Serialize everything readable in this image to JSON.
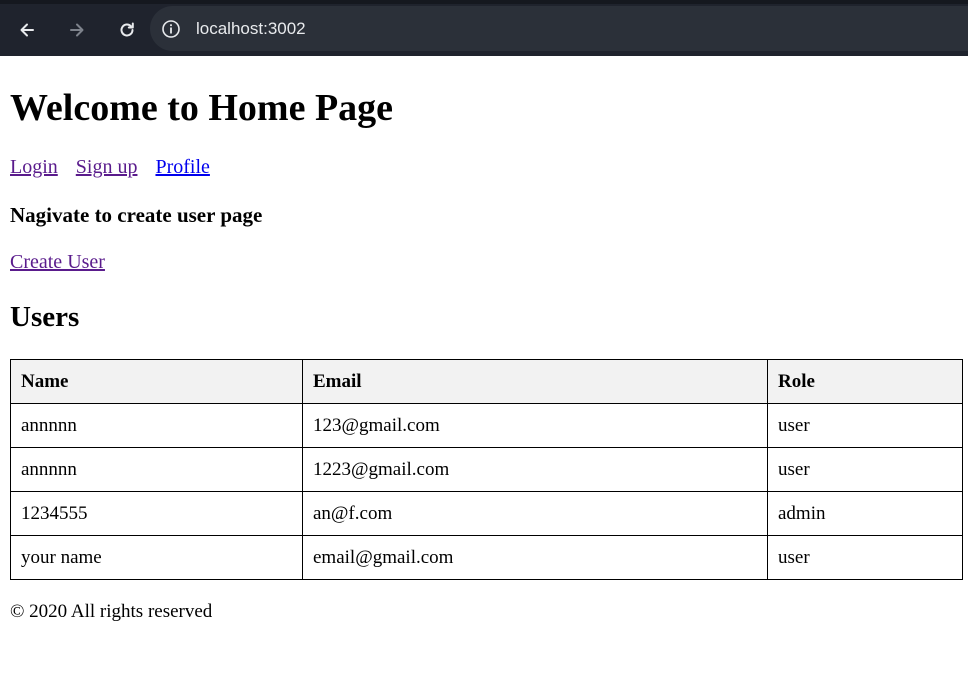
{
  "browser": {
    "url": "localhost:3002",
    "icons": [
      "back-arrow-icon",
      "forward-arrow-icon",
      "reload-icon",
      "info-icon"
    ]
  },
  "page": {
    "title": "Welcome to Home Page",
    "nav_links": [
      "Login",
      "Sign up",
      "Profile"
    ],
    "create_heading": "Nagivate to create user page",
    "create_link": "Create User",
    "users_heading": "Users",
    "table": {
      "headers": [
        "Name",
        "Email",
        "Role"
      ],
      "rows": [
        [
          "annnnn",
          "123@gmail.com",
          "user"
        ],
        [
          "annnnn",
          "1223@gmail.com",
          "user"
        ],
        [
          "1234555",
          "an@f.com",
          "admin"
        ],
        [
          "your name",
          "email@gmail.com",
          "user"
        ]
      ]
    },
    "footer": "© 2020 All rights reserved"
  },
  "colors": {
    "toolbar_bg": "#1f232d",
    "address_bg": "#2b3039",
    "visited_link": "#5a1b8c",
    "unvisited_link": "#0000ee",
    "table_header_bg": "#f2f2f2"
  }
}
